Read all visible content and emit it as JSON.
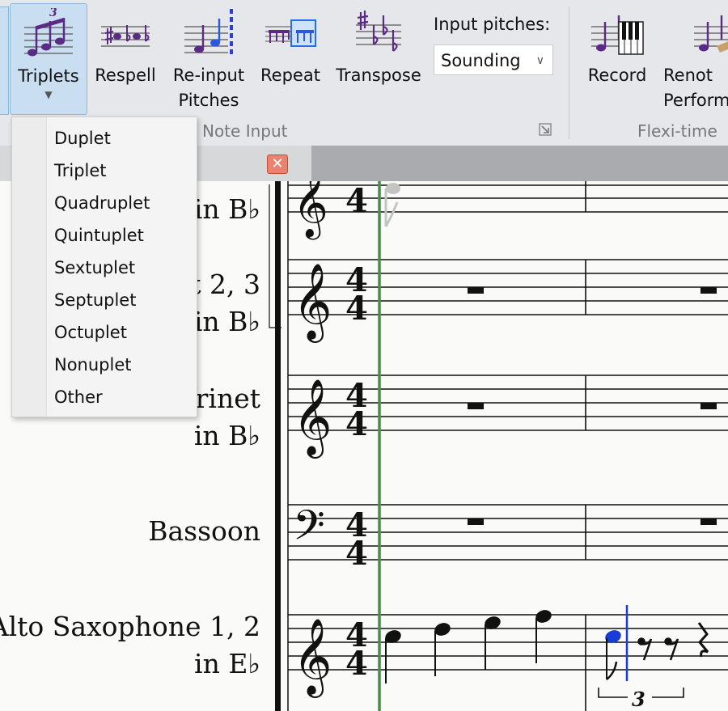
{
  "ribbon": {
    "buttons": [
      {
        "id": "triplets",
        "label": "Triplets"
      },
      {
        "id": "respell",
        "label": "Respell"
      },
      {
        "id": "reinput",
        "label": "Re-input\nPitches"
      },
      {
        "id": "repeat",
        "label": "Repeat"
      },
      {
        "id": "transpose",
        "label": "Transpose"
      },
      {
        "id": "record",
        "label": "Record"
      },
      {
        "id": "renotate",
        "label": "Renot\nPerform"
      }
    ],
    "input_pitches_label": "Input pitches:",
    "input_pitches_value": "Sounding",
    "group_note_input": "Note Input",
    "group_flexi_time": "Flexi-time"
  },
  "triplet_glyph": "3",
  "menu": {
    "items": [
      "Duplet",
      "Triplet",
      "Quadruplet",
      "Quintuplet",
      "Sextuplet",
      "Septuplet",
      "Octuplet",
      "Nonuplet",
      "Other"
    ]
  },
  "score": {
    "instruments": [
      {
        "line1": "in B♭"
      },
      {
        "line1": "t 2, 3",
        "line2": "in B♭"
      },
      {
        "line1": "rinet",
        "line2": "in B♭"
      },
      {
        "line1": "Bassoon"
      },
      {
        "line1": "Alto Saxophone 1, 2",
        "line2": "in E♭"
      }
    ],
    "time_signature": [
      "4",
      "4"
    ],
    "tuplet_number": "3"
  },
  "colors": {
    "selection": "#1a3cd6",
    "playline": "#4a8c4a",
    "accent": "#5b2a86"
  }
}
